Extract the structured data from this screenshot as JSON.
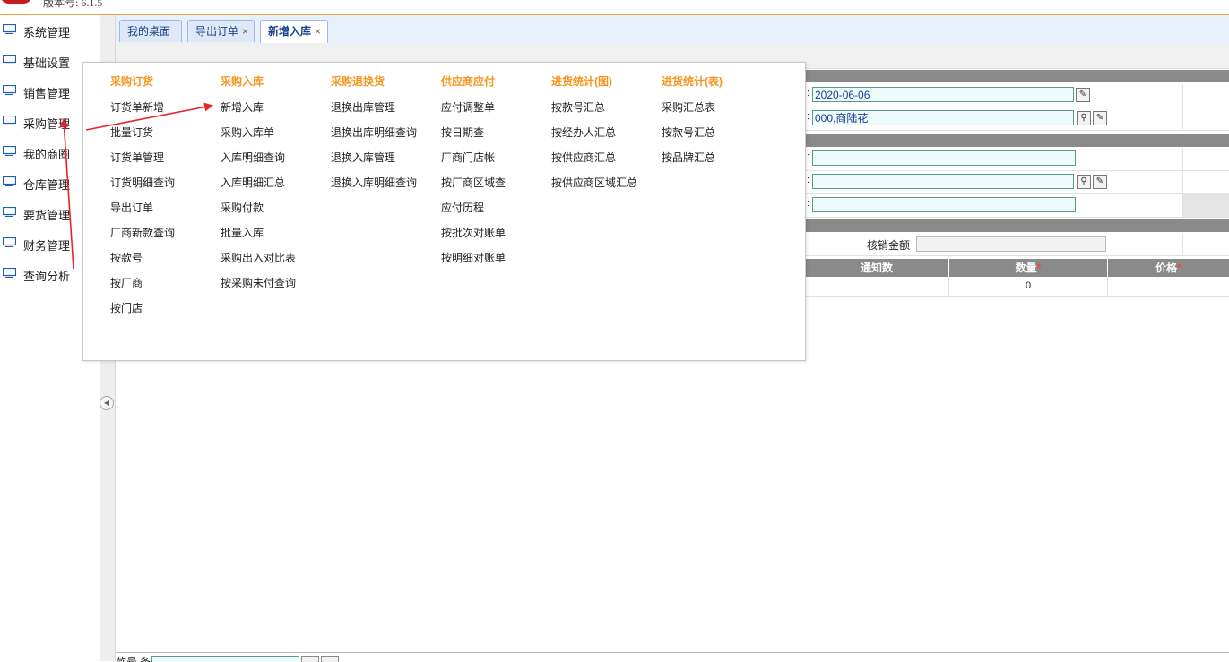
{
  "app": {
    "version": "版本号: 6.1.5"
  },
  "sidebar": {
    "items": [
      {
        "label": "系统管理"
      },
      {
        "label": "基础设置"
      },
      {
        "label": "销售管理"
      },
      {
        "label": "采购管理"
      },
      {
        "label": "我的商圈"
      },
      {
        "label": "仓库管理"
      },
      {
        "label": "要货管理"
      },
      {
        "label": "财务管理"
      },
      {
        "label": "查询分析"
      }
    ]
  },
  "tabs": [
    {
      "label": "我的桌面",
      "closable": false
    },
    {
      "label": "导出订单",
      "closable": true
    },
    {
      "label": "新增入库",
      "closable": true,
      "active": true
    }
  ],
  "tab_close_glyph": "×",
  "form": {
    "date_value": "2020-06-06",
    "supplier_value": "000,商陆花",
    "writeoff_label": "核销金额"
  },
  "grid": {
    "columns": [
      {
        "label": "通知数",
        "required": false
      },
      {
        "label": "数量",
        "required": true
      },
      {
        "label": "价格",
        "required": true
      }
    ],
    "required_mark": "*",
    "row": {
      "qty": "0"
    }
  },
  "bottom": {
    "label": "款号 条"
  },
  "mega_menu": {
    "columns": [
      {
        "title": "采购订货",
        "items": [
          "订货单新增",
          "批量订货",
          "订货单管理",
          "订货明细查询",
          "导出订单",
          "厂商新款查询",
          "按款号",
          "按厂商",
          "按门店"
        ]
      },
      {
        "title": "采购入库",
        "items": [
          "新增入库",
          "采购入库单",
          "入库明细查询",
          "入库明细汇总",
          "采购付款",
          "批量入库",
          "采购出入对比表",
          "按采购未付查询"
        ]
      },
      {
        "title": "采购退换货",
        "items": [
          "退换出库管理",
          "退换出库明细查询",
          "退换入库管理",
          "退换入库明细查询"
        ]
      },
      {
        "title": "供应商应付",
        "items": [
          "应付调整单",
          "按日期查",
          "厂商门店帐",
          "按厂商区域查",
          "应付历程",
          "按批次对账单",
          "按明细对账单"
        ]
      },
      {
        "title": "进货统计(图)",
        "items": [
          "按款号汇总",
          "按经办人汇总",
          "按供应商汇总",
          "按供应商区域汇总"
        ]
      },
      {
        "title": "进货统计(表)",
        "items": [
          "采购汇总表",
          "按款号汇总",
          "按品牌汇总"
        ]
      }
    ]
  },
  "colors": {
    "menu_header": "#f7941d",
    "annotation_arrow": "#e8232a",
    "tab_border": "#99bbe8"
  }
}
